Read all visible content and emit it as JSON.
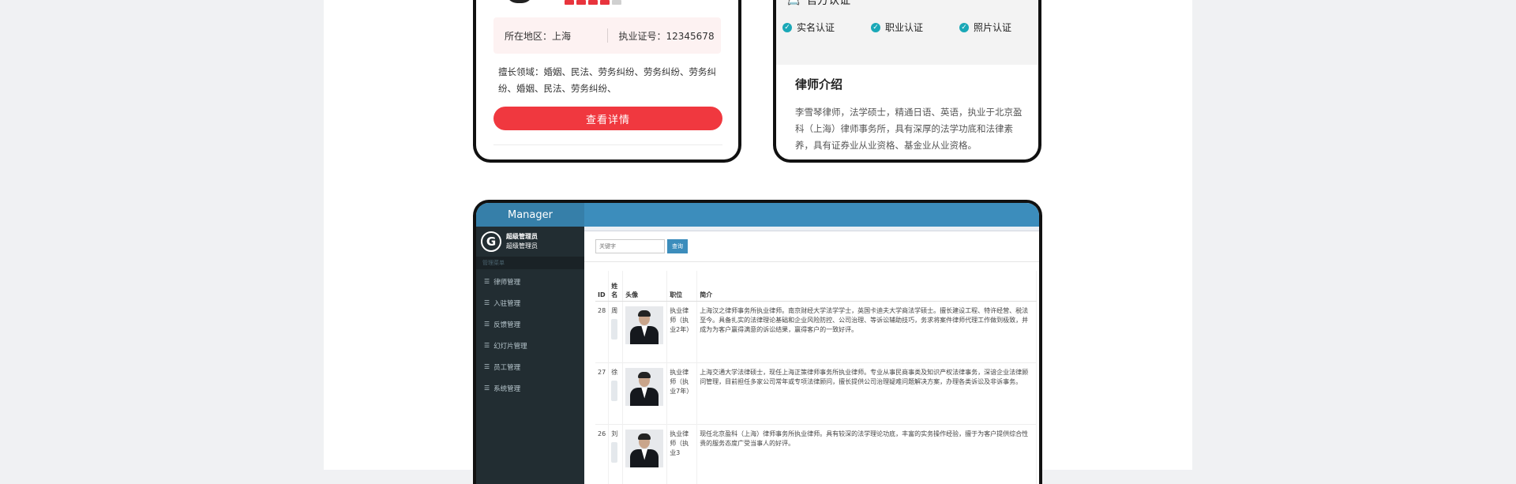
{
  "left_card": {
    "stars": [
      true,
      true,
      true,
      true,
      false
    ],
    "region_label": "所在地区：上海",
    "license_label": "执业证号：12345678",
    "specialty_text": "擅长领域：婚姻、民法、劳务纠纷、劳务纠纷、劳务纠纷、婚姻、民法、劳务纠纷、",
    "detail_button": "查看详情"
  },
  "right_card": {
    "official_title": "官方认证",
    "certs": [
      "实名认证",
      "职业认证",
      "照片认证"
    ],
    "intro_title": "律师介绍",
    "intro_text": "李雪琴律师，法学硕士，精通日语、英语，执业于北京盈科（上海）律师事务所，具有深厚的法学功底和法律素养，具有证券业从业资格、基金业从业资格。"
  },
  "admin": {
    "brand": "Manager",
    "user_name": "超级管理员",
    "user_role": "超级管理员",
    "nav_header": "管理菜单",
    "nav_items": [
      "律师管理",
      "入驻管理",
      "反馈管理",
      "幻灯片管理",
      "员工管理",
      "系统管理"
    ],
    "search_placeholder": "关键字",
    "search_button": "查询",
    "table_headers": {
      "id": "ID",
      "name": "姓名",
      "photo": "头像",
      "position": "职位",
      "intro": "简介"
    },
    "rows": [
      {
        "id": "28",
        "name": "周",
        "position": "执业律师（执业2年）",
        "intro": "上海汉之律师事务所执业律师。南京财经大学法学学士，英国卡迪夫大学商法学硕士。擅长建设工程、特许经营、税法至今。具备扎实的法律理论基础和企业风险防控、公司治理、等诉讼辅助技巧，务求将案件律师代理工作做到极致，并成为为客户赢得满意的诉讼结果，赢得客户的一致好评。"
      },
      {
        "id": "27",
        "name": "徐",
        "position": "执业律师（执业7年）",
        "intro": "上海交通大学法律硕士，现任上海正策律师事务所执业律师。专业从事民商事类及知识产权法律事务，深谙企业法律顾问管理，目前担任多家公司常年或专项法律顾问，擅长提供公司治理疑难问题解决方案，办理各类诉讼及非诉事务。"
      },
      {
        "id": "26",
        "name": "刘",
        "position": "执业律师（执业3",
        "intro": "现任北京盈科（上海）律师事务所执业律师。具有较深的法学理论功底，丰富的实务操作经验，擅于为客户提供综合性贵的服务态度广受当事人的好评。"
      }
    ]
  }
}
